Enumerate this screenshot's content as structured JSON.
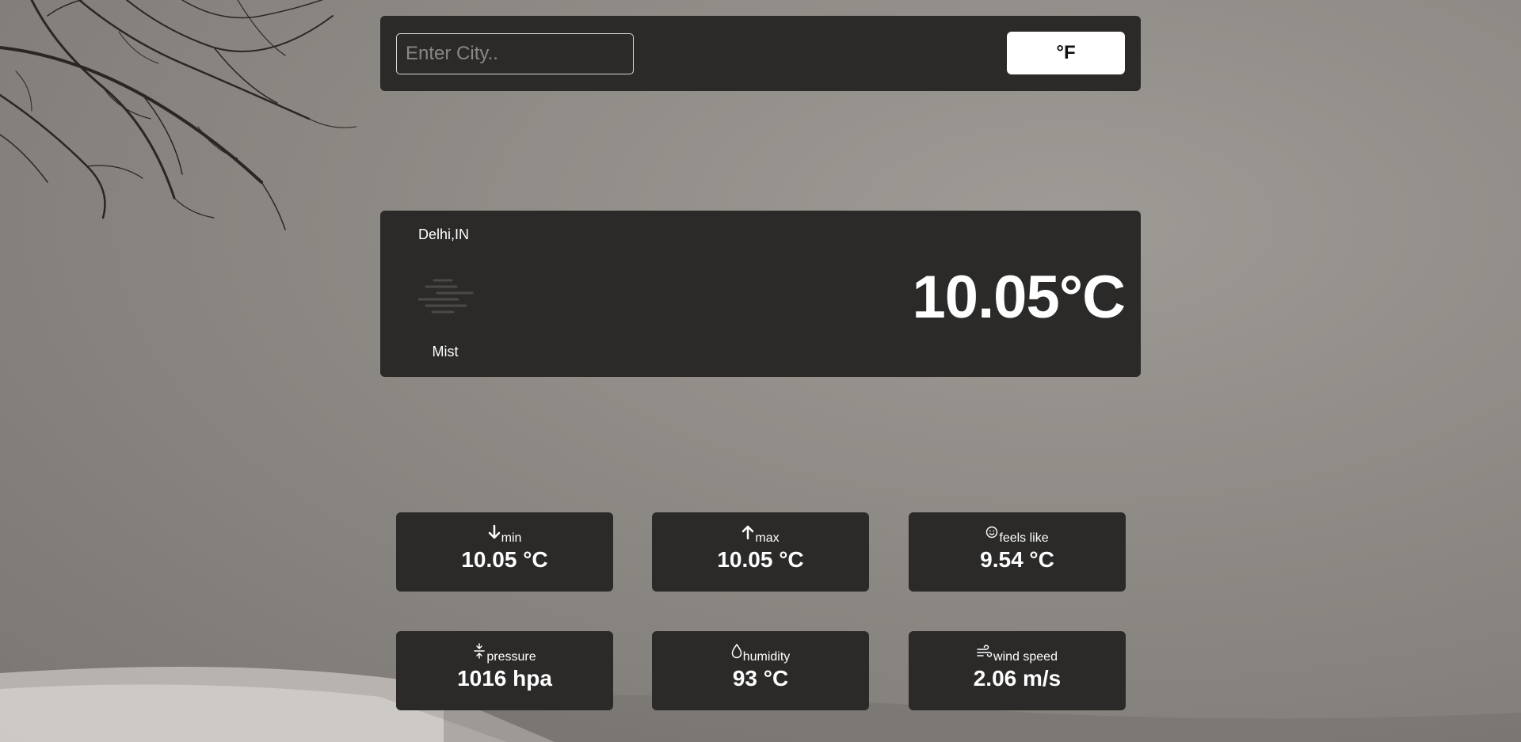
{
  "search": {
    "placeholder": "Enter City.."
  },
  "unit_toggle": {
    "label": "°F"
  },
  "current": {
    "location": "Delhi,IN",
    "condition": "Mist",
    "temperature": "10.05°C"
  },
  "stats": [
    {
      "key": "min",
      "label": "min",
      "value": "10.05 °C",
      "icon": "arrow-down-icon"
    },
    {
      "key": "max",
      "label": "max",
      "value": "10.05 °C",
      "icon": "arrow-up-icon"
    },
    {
      "key": "feels_like",
      "label": "feels like",
      "value": "9.54 °C",
      "icon": "smiley-icon"
    },
    {
      "key": "pressure",
      "label": "pressure",
      "value": "1016 hpa",
      "icon": "pressure-icon"
    },
    {
      "key": "humidity",
      "label": "humidity",
      "value": "93 °C",
      "icon": "droplet-icon"
    },
    {
      "key": "wind_speed",
      "label": "wind speed",
      "value": "2.06 m/s",
      "icon": "wind-icon"
    }
  ],
  "colors": {
    "card": "#2b2a29",
    "button_bg": "#ffffff",
    "text": "#ffffff"
  }
}
